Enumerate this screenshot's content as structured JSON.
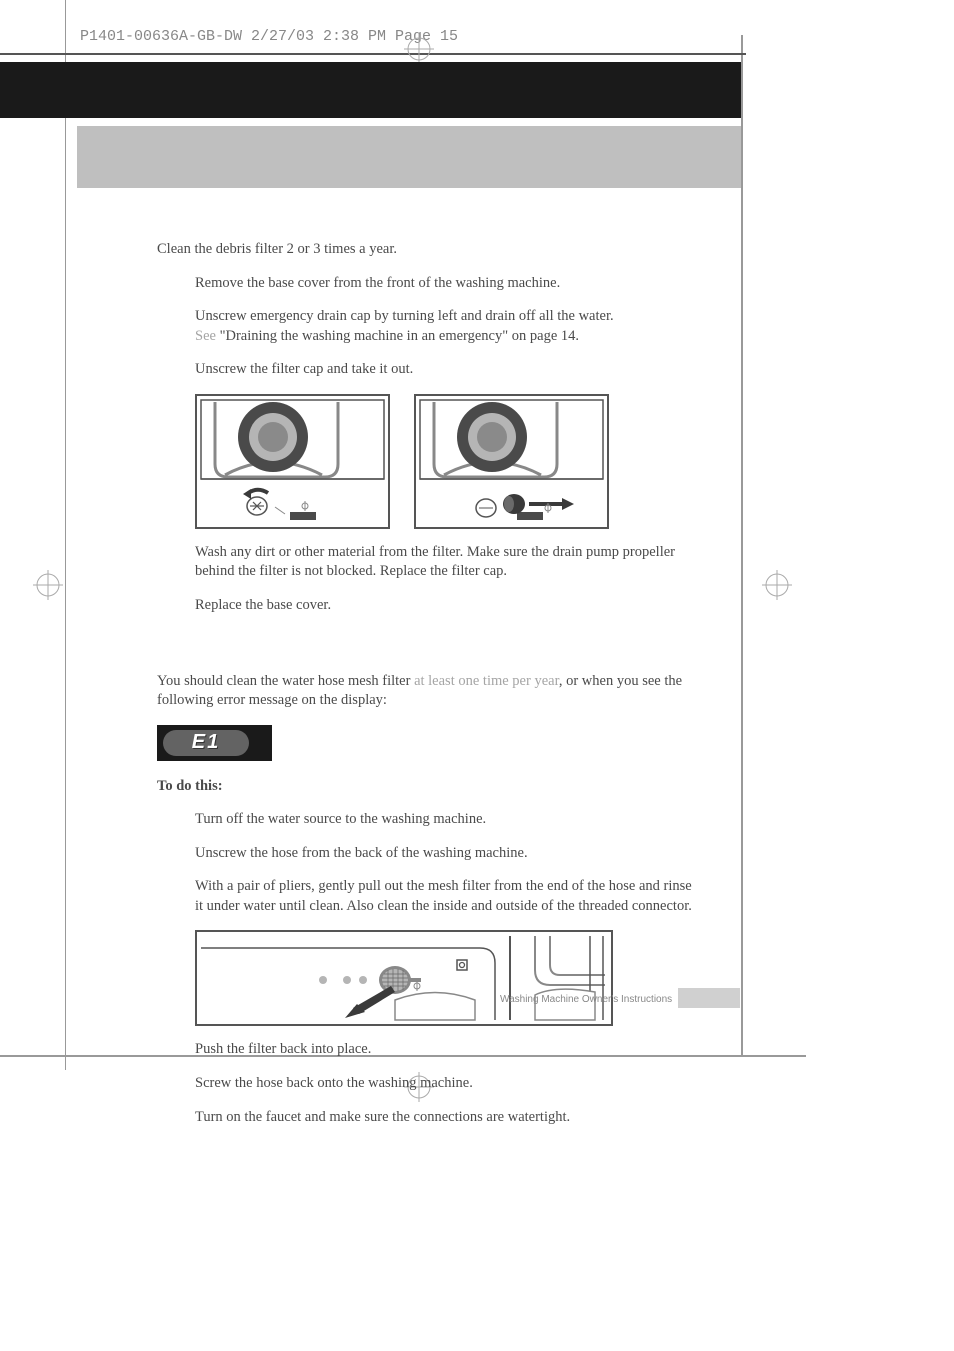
{
  "printHeader": "P1401-00636A-GB-DW  2/27/03 2:38 PM  Page 15",
  "section1": {
    "intro": "Clean the debris filter 2 or 3 times a year.",
    "steps": {
      "s1": "Remove the base cover from the front of the washing machine.",
      "s2a": "Unscrew emergency drain cap by turning left and drain off all the water.",
      "s2see": "See ",
      "s2b": "\"Draining the washing machine in an emergency\" on page 14.",
      "s3": "Unscrew the filter cap and take it out.",
      "s4": "Wash any dirt or other material from the filter.  Make sure the drain pump propeller behind the filter is not blocked. Replace the filter cap.",
      "s5": "Replace the base cover."
    }
  },
  "section2": {
    "introA": "You should clean the water hose mesh filter ",
    "introGrey": "at least one time per year",
    "introB": ", or when you see the following error message on the display:",
    "errorCode": "E1",
    "todo": "To do this:",
    "steps": {
      "s1": "Turn off the water source to the washing machine.",
      "s2": "Unscrew the hose from the back of the washing machine.",
      "s3": "With a pair of pliers, gently pull out the mesh filter from the end of the hose and rinse it under water until clean.  Also clean the inside and outside of the threaded connector.",
      "s4": "Push the filter back into place.",
      "s5": "Screw the hose back onto the washing machine.",
      "s6": "Turn on the faucet and make sure the connections are watertight."
    }
  },
  "footer": "Washing Machine Owner's Instructions"
}
